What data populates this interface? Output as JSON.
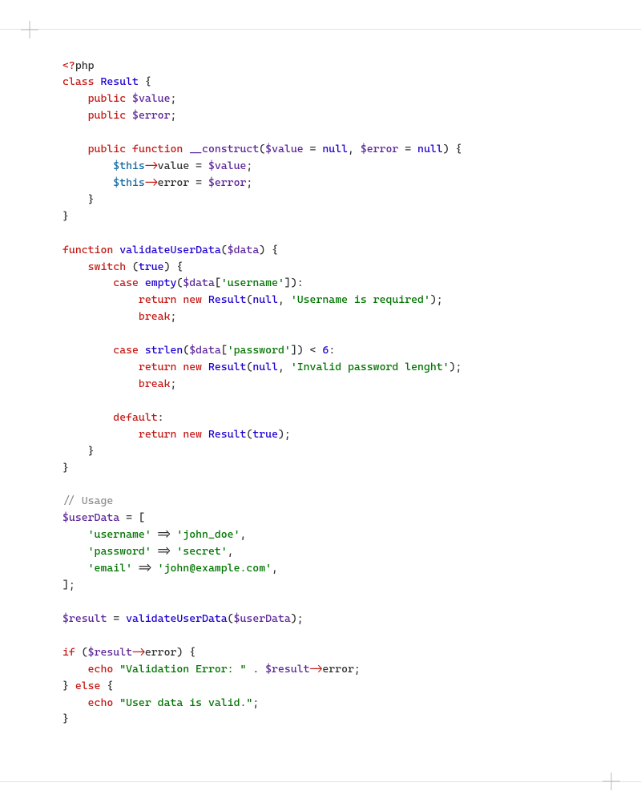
{
  "language": "php",
  "colors": {
    "keyword": "#c41a16",
    "func": "#1c00cf",
    "name": "#5c2699",
    "variable": "#5c2699",
    "this": "#0f68a0",
    "string": "#007400",
    "comment": "#8e8e93",
    "text": "#333333"
  },
  "lines": [
    [
      [
        "pi",
        "<?"
      ],
      [
        "t",
        "php"
      ]
    ],
    [
      [
        "kw",
        "class"
      ],
      [
        "t",
        " "
      ],
      [
        "fn",
        "Result"
      ],
      [
        "t",
        " {"
      ]
    ],
    [
      [
        "t",
        "    "
      ],
      [
        "kw",
        "public"
      ],
      [
        "t",
        " "
      ],
      [
        "va",
        "$value"
      ],
      [
        "t",
        ";"
      ]
    ],
    [
      [
        "t",
        "    "
      ],
      [
        "kw",
        "public"
      ],
      [
        "t",
        " "
      ],
      [
        "va",
        "$error"
      ],
      [
        "t",
        ";"
      ]
    ],
    [],
    [
      [
        "t",
        "    "
      ],
      [
        "kw",
        "public"
      ],
      [
        "t",
        " "
      ],
      [
        "kw",
        "function"
      ],
      [
        "t",
        " "
      ],
      [
        "nm",
        "__construct"
      ],
      [
        "t",
        "("
      ],
      [
        "va",
        "$value"
      ],
      [
        "t",
        " = "
      ],
      [
        "fn",
        "null"
      ],
      [
        "t",
        ", "
      ],
      [
        "va",
        "$error"
      ],
      [
        "t",
        " = "
      ],
      [
        "fn",
        "null"
      ],
      [
        "t",
        ") {"
      ]
    ],
    [
      [
        "t",
        "        "
      ],
      [
        "vt",
        "$this"
      ],
      [
        "op",
        "->"
      ],
      [
        "t",
        "value = "
      ],
      [
        "va",
        "$value"
      ],
      [
        "t",
        ";"
      ]
    ],
    [
      [
        "t",
        "        "
      ],
      [
        "vt",
        "$this"
      ],
      [
        "op",
        "->"
      ],
      [
        "t",
        "error = "
      ],
      [
        "va",
        "$error"
      ],
      [
        "t",
        ";"
      ]
    ],
    [
      [
        "t",
        "    }"
      ]
    ],
    [
      [
        "t",
        "}"
      ]
    ],
    [],
    [
      [
        "kw",
        "function"
      ],
      [
        "t",
        " "
      ],
      [
        "fn",
        "validateUserData"
      ],
      [
        "t",
        "("
      ],
      [
        "va",
        "$data"
      ],
      [
        "t",
        ") {"
      ]
    ],
    [
      [
        "t",
        "    "
      ],
      [
        "kw",
        "switch"
      ],
      [
        "t",
        " ("
      ],
      [
        "fn",
        "true"
      ],
      [
        "t",
        ") {"
      ]
    ],
    [
      [
        "t",
        "        "
      ],
      [
        "kw",
        "case"
      ],
      [
        "t",
        " "
      ],
      [
        "fn",
        "empty"
      ],
      [
        "t",
        "("
      ],
      [
        "va",
        "$data"
      ],
      [
        "t",
        "["
      ],
      [
        "st",
        "'username'"
      ],
      [
        "t",
        "]):"
      ]
    ],
    [
      [
        "t",
        "            "
      ],
      [
        "kw",
        "return"
      ],
      [
        "t",
        " "
      ],
      [
        "kw",
        "new"
      ],
      [
        "t",
        " "
      ],
      [
        "fn",
        "Result"
      ],
      [
        "t",
        "("
      ],
      [
        "fn",
        "null"
      ],
      [
        "t",
        ", "
      ],
      [
        "st",
        "'Username is required'"
      ],
      [
        "t",
        ");"
      ]
    ],
    [
      [
        "t",
        "            "
      ],
      [
        "kw",
        "break"
      ],
      [
        "t",
        ";"
      ]
    ],
    [],
    [
      [
        "t",
        "        "
      ],
      [
        "kw",
        "case"
      ],
      [
        "t",
        " "
      ],
      [
        "fn",
        "strlen"
      ],
      [
        "t",
        "("
      ],
      [
        "va",
        "$data"
      ],
      [
        "t",
        "["
      ],
      [
        "st",
        "'password'"
      ],
      [
        "t",
        "]) < "
      ],
      [
        "fn",
        "6"
      ],
      [
        "t",
        ":"
      ]
    ],
    [
      [
        "t",
        "            "
      ],
      [
        "kw",
        "return"
      ],
      [
        "t",
        " "
      ],
      [
        "kw",
        "new"
      ],
      [
        "t",
        " "
      ],
      [
        "fn",
        "Result"
      ],
      [
        "t",
        "("
      ],
      [
        "fn",
        "null"
      ],
      [
        "t",
        ", "
      ],
      [
        "st",
        "'Invalid password lenght'"
      ],
      [
        "t",
        ");"
      ]
    ],
    [
      [
        "t",
        "            "
      ],
      [
        "kw",
        "break"
      ],
      [
        "t",
        ";"
      ]
    ],
    [],
    [
      [
        "t",
        "        "
      ],
      [
        "kw",
        "default"
      ],
      [
        "t",
        ":"
      ]
    ],
    [
      [
        "t",
        "            "
      ],
      [
        "kw",
        "return"
      ],
      [
        "t",
        " "
      ],
      [
        "kw",
        "new"
      ],
      [
        "t",
        " "
      ],
      [
        "fn",
        "Result"
      ],
      [
        "t",
        "("
      ],
      [
        "fn",
        "true"
      ],
      [
        "t",
        ");"
      ]
    ],
    [
      [
        "t",
        "    }"
      ]
    ],
    [
      [
        "t",
        "}"
      ]
    ],
    [],
    [
      [
        "cm",
        "// Usage"
      ]
    ],
    [
      [
        "va",
        "$userData"
      ],
      [
        "t",
        " = ["
      ]
    ],
    [
      [
        "t",
        "    "
      ],
      [
        "st",
        "'username'"
      ],
      [
        "t",
        " => "
      ],
      [
        "st",
        "'john_doe'"
      ],
      [
        "t",
        ","
      ]
    ],
    [
      [
        "t",
        "    "
      ],
      [
        "st",
        "'password'"
      ],
      [
        "t",
        " => "
      ],
      [
        "st",
        "'secret'"
      ],
      [
        "t",
        ","
      ]
    ],
    [
      [
        "t",
        "    "
      ],
      [
        "st",
        "'email'"
      ],
      [
        "t",
        " => "
      ],
      [
        "st",
        "'john@example.com'"
      ],
      [
        "t",
        ","
      ]
    ],
    [
      [
        "t",
        "];"
      ]
    ],
    [],
    [
      [
        "va",
        "$result"
      ],
      [
        "t",
        " = "
      ],
      [
        "fn",
        "validateUserData"
      ],
      [
        "t",
        "("
      ],
      [
        "va",
        "$userData"
      ],
      [
        "t",
        ");"
      ]
    ],
    [],
    [
      [
        "kw",
        "if"
      ],
      [
        "t",
        " ("
      ],
      [
        "va",
        "$result"
      ],
      [
        "op",
        "->"
      ],
      [
        "t",
        "error) {"
      ]
    ],
    [
      [
        "t",
        "    "
      ],
      [
        "kw",
        "echo"
      ],
      [
        "t",
        " "
      ],
      [
        "st",
        "\"Validation Error: \""
      ],
      [
        "t",
        " . "
      ],
      [
        "va",
        "$result"
      ],
      [
        "op",
        "->"
      ],
      [
        "t",
        "error;"
      ]
    ],
    [
      [
        "t",
        "} "
      ],
      [
        "kw",
        "else"
      ],
      [
        "t",
        " {"
      ]
    ],
    [
      [
        "t",
        "    "
      ],
      [
        "kw",
        "echo"
      ],
      [
        "t",
        " "
      ],
      [
        "st",
        "\"User data is valid.\""
      ],
      [
        "t",
        ";"
      ]
    ],
    [
      [
        "t",
        "}"
      ]
    ]
  ]
}
